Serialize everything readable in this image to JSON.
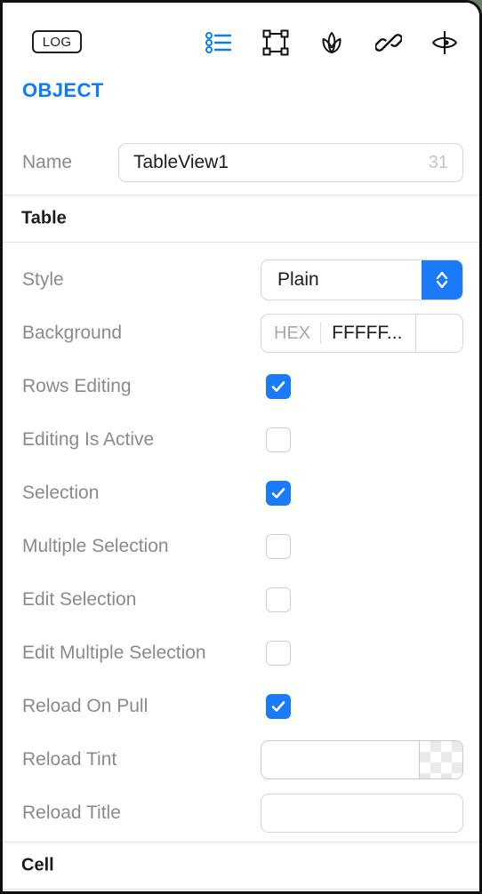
{
  "window": {
    "frame_color": "#101010",
    "background": "#ffffff"
  },
  "toolbar": {
    "log_button": "LOG",
    "icons": [
      {
        "name": "list-icon",
        "color": "#0a7cff"
      },
      {
        "name": "bounding-box-icon",
        "color": "#111111"
      },
      {
        "name": "tulip-icon",
        "color": "#111111"
      },
      {
        "name": "link-icon",
        "color": "#111111"
      },
      {
        "name": "eye-icon",
        "color": "#111111"
      }
    ]
  },
  "object_section": {
    "heading": "OBJECT",
    "heading_color": "#0a7cff",
    "name_row": {
      "label": "Name",
      "value": "TableView1",
      "counter": "31"
    }
  },
  "table_section": {
    "header": "Table",
    "style_row": {
      "label": "Style",
      "value": "Plain",
      "stepper_color": "#1a7af8"
    },
    "background_row": {
      "label": "Background",
      "hex_tag": "HEX",
      "value": "FFFFF...",
      "swatch_color": "#ffffff"
    },
    "toggles": [
      {
        "label": "Rows Editing",
        "checked": true
      },
      {
        "label": "Editing Is Active",
        "checked": false
      },
      {
        "label": "Selection",
        "checked": true
      },
      {
        "label": "Multiple Selection",
        "checked": false
      },
      {
        "label": "Edit Selection",
        "checked": false
      },
      {
        "label": "Edit Multiple Selection",
        "checked": false
      },
      {
        "label": "Reload On Pull",
        "checked": true
      }
    ],
    "reload_tint_row": {
      "label": "Reload Tint",
      "value": "",
      "swatch": "transparent-checkerboard"
    },
    "reload_title_row": {
      "label": "Reload Title",
      "value": ""
    }
  },
  "cell_section": {
    "header": "Cell"
  },
  "colors": {
    "accent": "#0a7cff",
    "control_blue": "#1a7af8",
    "label_gray": "#8a8a8e",
    "text_dark": "#1c1c1e",
    "divider": "#e2e2e4",
    "field_border": "#d6d6d8"
  }
}
